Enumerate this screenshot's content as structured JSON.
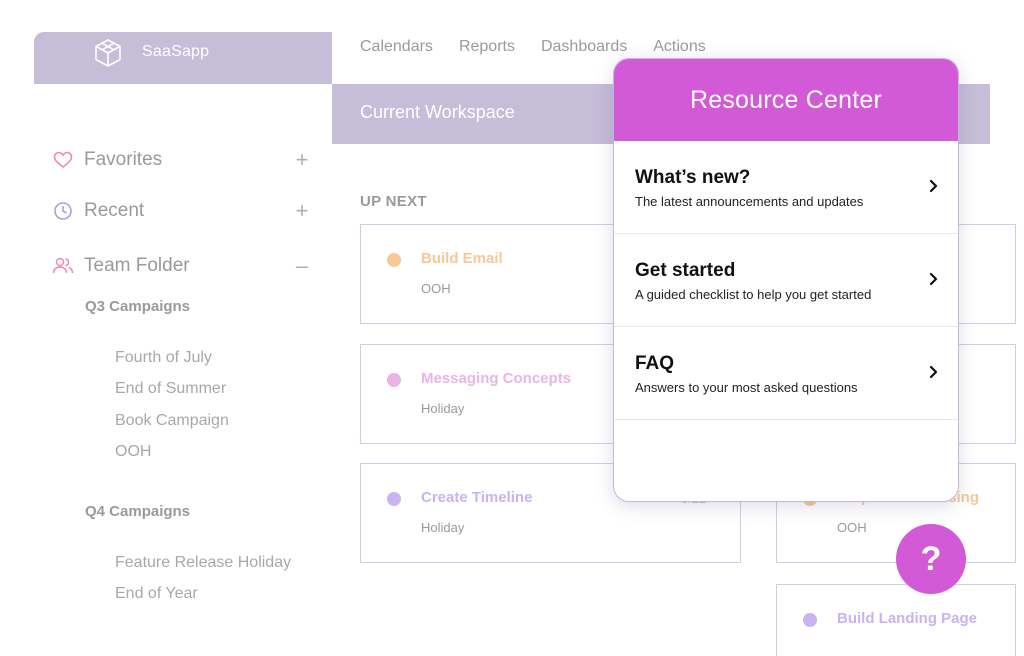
{
  "brand": {
    "name": "SaaSapp",
    "icon": "cube-icon"
  },
  "topnav": [
    "Calendars",
    "Reports",
    "Dashboards",
    "Actions"
  ],
  "workspace": {
    "title": "Current Workspace"
  },
  "sidebar": {
    "items": [
      {
        "label": "Favorites",
        "icon": "heart-icon",
        "toggle": "+"
      },
      {
        "label": "Recent",
        "icon": "clock-icon",
        "toggle": "+"
      },
      {
        "label": "Team Folder",
        "icon": "users-icon",
        "toggle": "–"
      }
    ],
    "sections": [
      {
        "title": "Q3 Campaigns",
        "items": [
          "Fourth of July",
          "End of Summer",
          "Book Campaign",
          "OOH"
        ]
      },
      {
        "title": "Q4 Campaigns",
        "items": [
          "Feature Release Holiday",
          "End of Year"
        ]
      }
    ]
  },
  "upnext": {
    "heading": "UP NEXT",
    "cards": [
      {
        "title": "Build Email",
        "sub": "OOH",
        "date": "",
        "color": "#f7c898"
      },
      {
        "title": "Messaging Concepts",
        "sub": "Holiday",
        "date": "",
        "color": "#eab3ea"
      },
      {
        "title": "Create Timeline",
        "sub": "Holiday",
        "date": "6/21",
        "color": "#c9b3f0"
      },
      {
        "title": "Prepare Advertising",
        "sub": "OOH",
        "date": "",
        "color": "#f7c898"
      },
      {
        "title": "Build Landing Page",
        "sub": "",
        "date": "",
        "color": "#c9b3f0"
      }
    ]
  },
  "resource_center": {
    "title": "Resource Center",
    "items": [
      {
        "title": "What’s new?",
        "desc": "The latest announcements and updates"
      },
      {
        "title": "Get started",
        "desc": "A guided checklist to help you get started"
      },
      {
        "title": "FAQ",
        "desc": "Answers to your most asked questions"
      }
    ]
  },
  "help_button": {
    "label": "?"
  },
  "colors": {
    "accent": "#d35ad6",
    "lavender": "#c6bdd8",
    "card_border": "#d3cbe6"
  }
}
